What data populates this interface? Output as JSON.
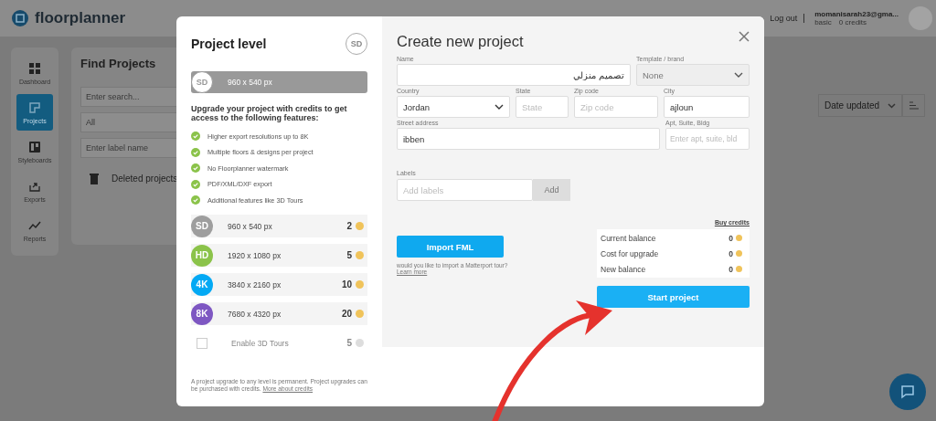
{
  "header": {
    "logo": "floorplanner",
    "logout": "Log out",
    "user_email": "momanisarah23@gma...",
    "plan": "basic",
    "credits": "0 credits"
  },
  "sidebar": {
    "items": [
      {
        "label": "Dashboard",
        "selected": false,
        "kind": "grid"
      },
      {
        "label": "Projects",
        "selected": true,
        "kind": "plan"
      },
      {
        "label": "Styleboards",
        "selected": false,
        "kind": "board"
      },
      {
        "label": "Exports",
        "selected": false,
        "kind": "export"
      },
      {
        "label": "Reports",
        "selected": false,
        "kind": "chart"
      }
    ]
  },
  "find_panel": {
    "title": "Find Projects",
    "search": {
      "placeholder": "Enter search..."
    },
    "filter": "All",
    "label_search": {
      "placeholder": "Enter label name"
    },
    "deleted": "Deleted projects"
  },
  "sort": {
    "value": "Date updated"
  },
  "modal": {
    "left": {
      "title": "Project level",
      "badge": "SD",
      "current_level": {
        "badge": "SD",
        "resolution": "960 x 540 px"
      },
      "intro": "Upgrade your project with credits to get access to the following features:",
      "features": [
        "Higher export resolutions up to 8K",
        "Multiple floors & designs per project",
        "No Floorplanner watermark",
        "PDF/XML/DXF export",
        "Additional features like 3D Tours"
      ],
      "levels": [
        {
          "badge": "SD",
          "color": "#9e9e9e",
          "resolution": "960 x 540 px",
          "credits": "2"
        },
        {
          "badge": "HD",
          "color": "#8bc34a",
          "resolution": "1920 x 1080 px",
          "credits": "5"
        },
        {
          "badge": "4K",
          "color": "#03a9f4",
          "resolution": "3840 x 2160 px",
          "credits": "10"
        },
        {
          "badge": "8K",
          "color": "#7e57c2",
          "resolution": "7680 x 4320 px",
          "credits": "20"
        }
      ],
      "tours": {
        "label": "Enable 3D Tours",
        "credits": "5",
        "checked": false
      },
      "note": "A project upgrade to any level is permanent. Project upgrades can be purchased with credits.",
      "note_link": "More about credits"
    },
    "right": {
      "title": "Create new project",
      "name": {
        "label": "Name",
        "value": "تصميم منزلي"
      },
      "template": {
        "label": "Template / brand",
        "value": "None"
      },
      "country": {
        "label": "Country",
        "value": "Jordan"
      },
      "state": {
        "label": "State",
        "placeholder": "State"
      },
      "zip": {
        "label": "Zip code",
        "placeholder": "Zip code"
      },
      "city": {
        "label": "City",
        "value": "ajloun"
      },
      "street": {
        "label": "Street address",
        "value": "ibben"
      },
      "apt": {
        "label": "Apt, Suite, Bldg",
        "placeholder": "Enter apt, suite, bld"
      },
      "labels": {
        "label": "Labels",
        "placeholder": "Add labels",
        "button": "Add"
      },
      "import_button": "Import FML",
      "import_note": "would you like to import a Matterport tour?",
      "learn_more": "Learn more",
      "buy_credits": "Buy credits",
      "balance": [
        {
          "label": "Current balance",
          "value": "0"
        },
        {
          "label": "Cost for upgrade",
          "value": "0"
        },
        {
          "label": "New balance",
          "value": "0"
        }
      ],
      "start_button": "Start project"
    }
  }
}
